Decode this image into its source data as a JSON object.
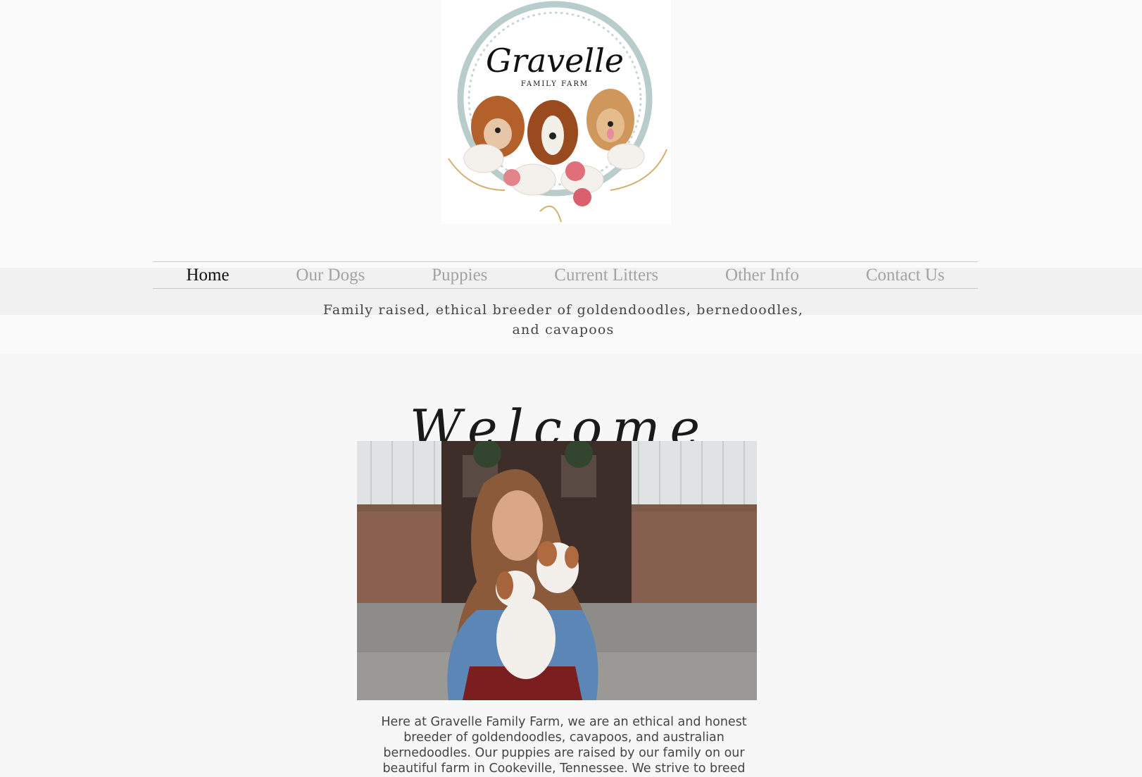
{
  "logo": {
    "title": "Gravelle",
    "subtitle": "FAMILY FARM"
  },
  "nav": {
    "items": [
      {
        "label": "Home",
        "active": true
      },
      {
        "label": "Our Dogs",
        "active": false
      },
      {
        "label": "Puppies",
        "active": false
      },
      {
        "label": "Current Litters",
        "active": false
      },
      {
        "label": "Other Info",
        "active": false
      },
      {
        "label": "Contact Us",
        "active": false
      }
    ]
  },
  "tagline": "Family raised, ethical breeder of goldendoodles, bernedoodles, and cavapoos",
  "welcome": "Welcome",
  "intro": "Here at Gravelle Family Farm, we are an ethical and honest breeder of goldendoodles, cavapoos, and australian bernedoodles. Our puppies are raised by our family on our beautiful farm in Cookeville, Tennessee. We strive to breed",
  "colors": {
    "nav_active": "#111111",
    "nav_inactive": "#a3a3a3",
    "logo_ring": "#b9cccc"
  }
}
